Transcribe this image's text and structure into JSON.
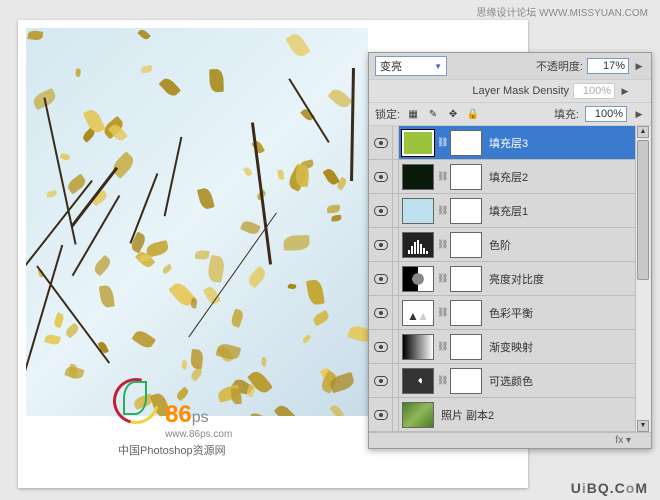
{
  "header": {
    "site_text": "思缘设计论坛  WWW.MISSYUAN.COM"
  },
  "watermark": {
    "num": "86",
    "ps": "ps",
    "url": "www.86ps.com",
    "subtitle": "中国Photoshop资源网"
  },
  "footer": {
    "uibq": "UiBQ.CoM"
  },
  "panel": {
    "blend": {
      "mode_value": "变亮",
      "opacity_label": "不透明度:",
      "opacity_value": "17%"
    },
    "density": {
      "label": "Layer Mask Density",
      "value": "100%"
    },
    "lock": {
      "label": "锁定:",
      "fill_label": "填充:",
      "fill_value": "100%"
    }
  },
  "layers": [
    {
      "name": "填充层3",
      "selected": true,
      "type": "fill",
      "color": "#9ac23a",
      "has_mask": true
    },
    {
      "name": "填充层2",
      "selected": false,
      "type": "fill",
      "color": "#0a1a0a",
      "has_mask": true
    },
    {
      "name": "填充层1",
      "selected": false,
      "type": "fill",
      "color": "#bde0ee",
      "has_mask": true
    },
    {
      "name": "色阶",
      "selected": false,
      "type": "levels",
      "has_mask": true
    },
    {
      "name": "亮度对比度",
      "selected": false,
      "type": "bc",
      "has_mask": true
    },
    {
      "name": "色彩平衡",
      "selected": false,
      "type": "balance",
      "has_mask": true
    },
    {
      "name": "渐变映射",
      "selected": false,
      "type": "gradient",
      "has_mask": true
    },
    {
      "name": "可选颜色",
      "selected": false,
      "type": "selective",
      "has_mask": true
    },
    {
      "name": "照片 副本2",
      "selected": false,
      "type": "photo",
      "has_mask": false
    }
  ]
}
